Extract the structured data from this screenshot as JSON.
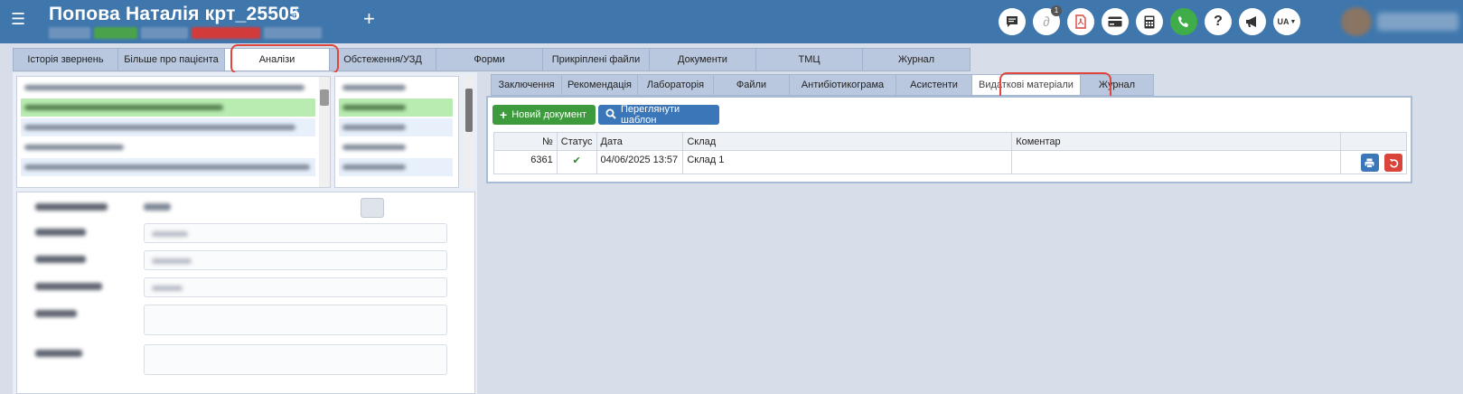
{
  "header": {
    "menu_icon": "menu-icon",
    "patient_name": "Попова Наталія крт_25505",
    "sex_icon": "♀",
    "add_label": "+",
    "notification_count": "1",
    "lang": "UA",
    "icons": [
      "chat-icon",
      "sign-icon",
      "pdf-icon",
      "card-icon",
      "calculator-icon",
      "phone-icon",
      "help-icon",
      "megaphone-icon"
    ],
    "colors": {
      "bar": "#3f77ad",
      "green": "#3fae49",
      "red": "#d9443b"
    }
  },
  "main_tabs": [
    {
      "label": "Історія звернень"
    },
    {
      "label": "Більше про пацієнта"
    },
    {
      "label": "Аналізи"
    },
    {
      "label": "Обстеження/УЗД"
    },
    {
      "label": "Форми"
    },
    {
      "label": "Прикріплені файли"
    },
    {
      "label": "Документи"
    },
    {
      "label": "ТМЦ"
    },
    {
      "label": "Журнал"
    }
  ],
  "sub_tabs": [
    {
      "label": "Заключення"
    },
    {
      "label": "Рекомендація"
    },
    {
      "label": "Лабораторія"
    },
    {
      "label": "Файли"
    },
    {
      "label": "Антибіотикограма"
    },
    {
      "label": "Асистенти"
    },
    {
      "label": "Видаткові матеріали"
    },
    {
      "label": "Журнал"
    }
  ],
  "toolbar": {
    "new_doc_label": "Новий документ",
    "view_template_label": "Переглянути шаблон"
  },
  "table": {
    "headers": {
      "num": "№",
      "status": "Статус",
      "date": "Дата",
      "warehouse": "Склад",
      "comment": "Коментар"
    },
    "rows": [
      {
        "num": "6361",
        "status_icon": "✔",
        "date": "04/06/2025 13:57",
        "warehouse": "Склад 1",
        "comment": ""
      }
    ]
  }
}
